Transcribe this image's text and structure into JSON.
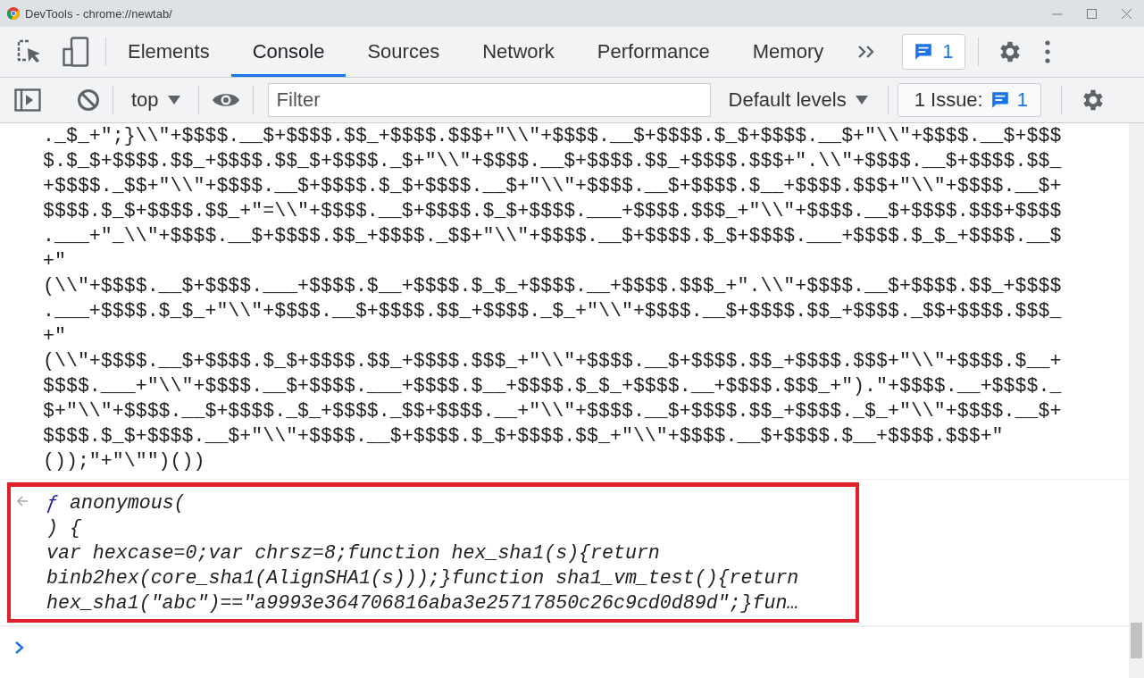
{
  "window": {
    "title": "DevTools - chrome://newtab/"
  },
  "tabs": [
    {
      "label": "Elements",
      "selected": false
    },
    {
      "label": "Console",
      "selected": true
    },
    {
      "label": "Sources",
      "selected": false
    },
    {
      "label": "Network",
      "selected": false
    },
    {
      "label": "Performance",
      "selected": false
    },
    {
      "label": "Memory",
      "selected": false
    }
  ],
  "messages_badge": {
    "count": "1"
  },
  "toolbar": {
    "context": "top",
    "filter": {
      "placeholder": "Filter"
    },
    "levels": "Default levels",
    "issues": {
      "label": "1 Issue:",
      "count": "1"
    }
  },
  "console": {
    "log_lines": [
      "._$_+\";}\\\\\"+$$$$.__$+$$$$.$$_+$$$$.$$$+\"\\\\\"+$$$$.__$+$$$$.$_$+$$$$.__$+\"\\\\\"+$$$$.__$+$$$",
      "$.$_$+$$$$.$$_+$$$$.$$_$+$$$$._$+\"\\\\\"+$$$$.__$+$$$$.$$_+$$$$.$$$+\".\\\\\"+$$$$.__$+$$$$.$$_",
      "+$$$$._$$+\"\\\\\"+$$$$.__$+$$$$.$_$+$$$$.__$+\"\\\\\"+$$$$.__$+$$$$.$__+$$$$.$$$+\"\\\\\"+$$$$.__$+",
      "$$$$.$_$+$$$$.$$_+\"=\\\\\"+$$$$.__$+$$$$.$_$+$$$$.___+$$$$.$$$_+\"\\\\\"+$$$$.__$+$$$$.$$$+$$$$",
      ".___+\"_\\\\\"+$$$$.__$+$$$$.$$_+$$$$._$$+\"\\\\\"+$$$$.__$+$$$$.$_$+$$$$.___+$$$$.$_$_+$$$$.__$",
      "+\"",
      "(\\\\\"+$$$$.__$+$$$$.___+$$$$.$__+$$$$.$_$_+$$$$.__+$$$$.$$$_+\".\\\\\"+$$$$.__$+$$$$.$$_+$$$$",
      ".___+$$$$.$_$_+\"\\\\\"+$$$$.__$+$$$$.$$_+$$$$._$_+\"\\\\\"+$$$$.__$+$$$$.$$_+$$$$._$$+$$$$.$$$_",
      "+\"",
      "(\\\\\"+$$$$.__$+$$$$.$_$+$$$$.$$_+$$$$.$$$_+\"\\\\\"+$$$$.__$+$$$$.$$_+$$$$.$$$+\"\\\\\"+$$$$.$__+",
      "$$$$.___+\"\\\\\"+$$$$.__$+$$$$.___+$$$$.$__+$$$$.$_$_+$$$$.__+$$$$.$$$_+\").\"+$$$$.__+$$$$._",
      "$+\"\\\\\"+$$$$.__$+$$$$._$_+$$$$._$$+$$$$.__+\"\\\\\"+$$$$.__$+$$$$.$$_+$$$$._$_+\"\\\\\"+$$$$.__$+",
      "$$$$.$_$+$$$$.__$+\"\\\\\"+$$$$.__$+$$$$.$_$+$$$$.$$_+\"\\\\\"+$$$$.__$+$$$$.$__+$$$$.$$$+\"",
      "());\"+\"\\\"\")())"
    ],
    "result": {
      "highlighted": true,
      "keyword": "ƒ",
      "lines": [
        "anonymous(",
        ") {",
        "var hexcase=0;var chrsz=8;function hex_sha1(s){return",
        "binb2hex(core_sha1(AlignSHA1(s)));}function sha1_vm_test(){return",
        "hex_sha1(\"abc\")==\"a9993e364706816aba3e25717850c26c9cd0d89d\";}fun…"
      ]
    }
  }
}
